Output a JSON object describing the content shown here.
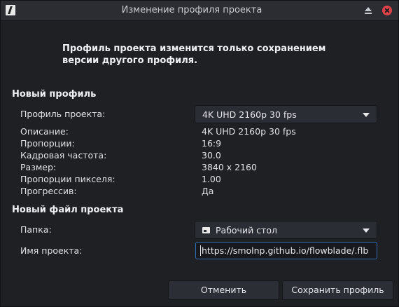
{
  "window": {
    "title": "Изменение профиля проекта",
    "controls": [
      "minimize-icon",
      "close-icon"
    ]
  },
  "message": "Профиль проекта изменится только сохранением версии другого профиля.",
  "new_profile": {
    "heading": "Новый профиль",
    "profile_label": "Профиль проекта:",
    "profile_value": "4K UHD 2160p 30 fps",
    "details": [
      {
        "label": "Описание:",
        "value": "4K UHD 2160p 30 fps"
      },
      {
        "label": "Пропорции:",
        "value": "16:9"
      },
      {
        "label": "Кадровая частота:",
        "value": "30.0"
      },
      {
        "label": "Размер:",
        "value": "3840 x 2160"
      },
      {
        "label": "Пропорции пикселя:",
        "value": "1.00"
      },
      {
        "label": "Прогрессив:",
        "value": "Да"
      }
    ]
  },
  "new_file": {
    "heading": "Новый файл проекта",
    "folder_label": "Папка:",
    "folder_value": "Рабочий стол",
    "folder_icon": "folder-icon",
    "name_label": "Имя проекта:",
    "name_value": "https://smolnp.github.io/flowblade/.flb"
  },
  "buttons": {
    "cancel": "Отменить",
    "save": "Сохранить профиль"
  },
  "colors": {
    "background": "#1e2024",
    "titlebar": "#2b2d32",
    "close": "#e0424a",
    "focus_border": "#2f6fb8"
  }
}
